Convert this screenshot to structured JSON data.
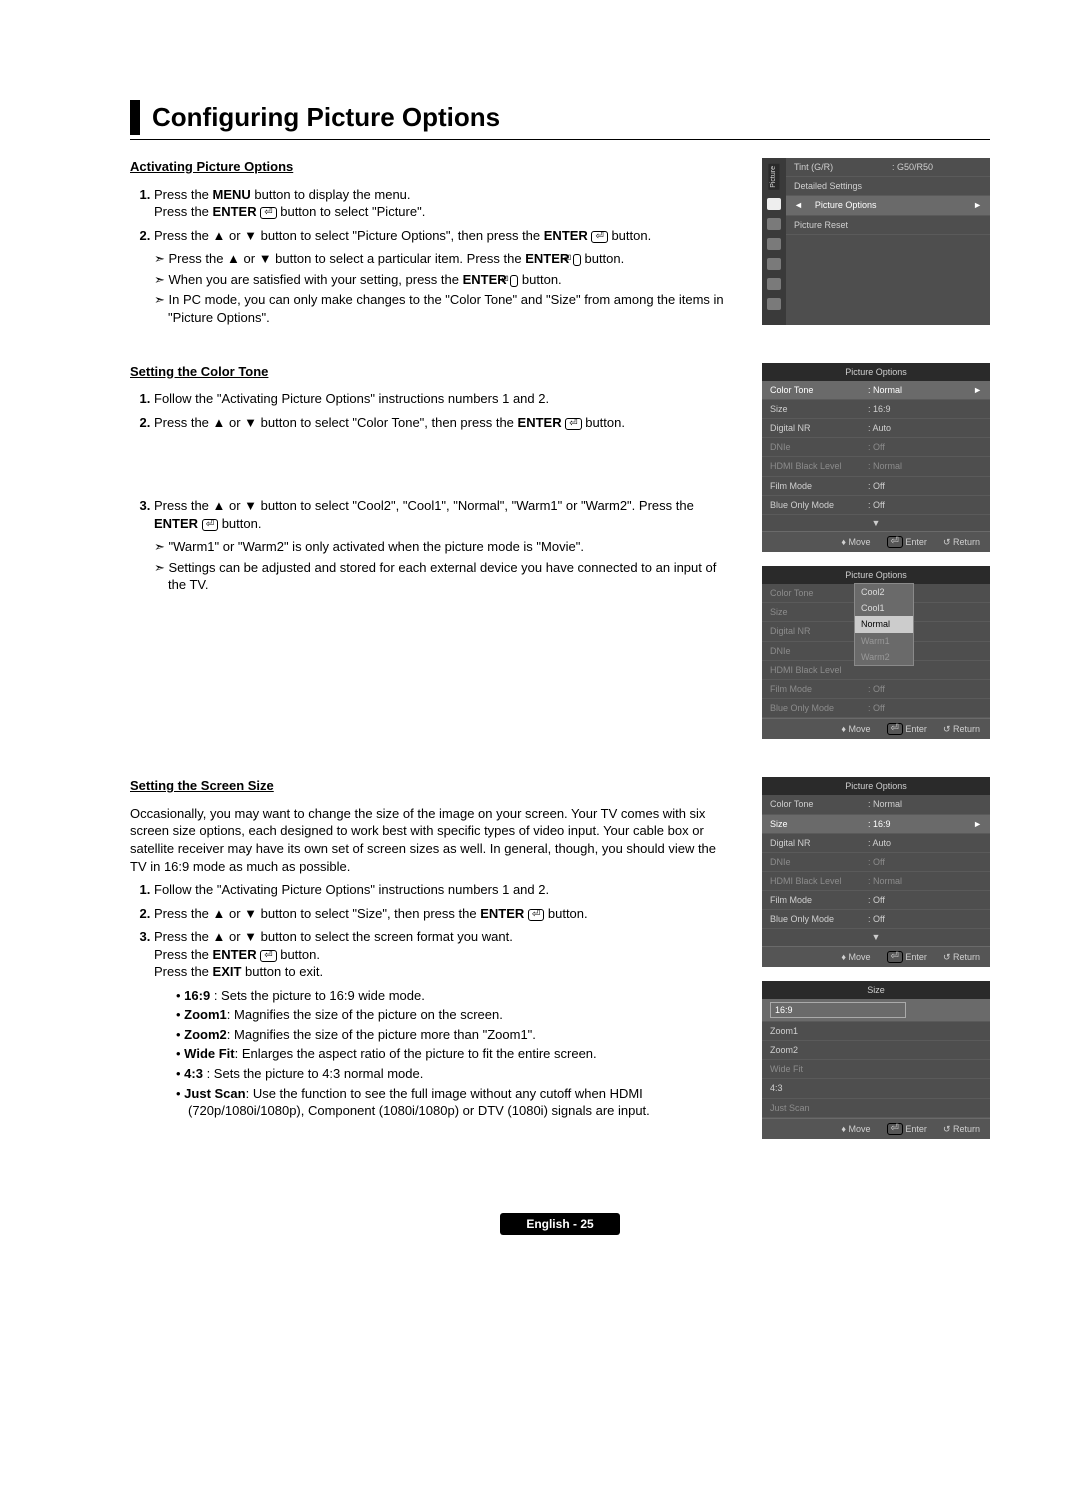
{
  "title": "Configuring Picture Options",
  "footer": "English - 25",
  "sectionA": {
    "subhead": "Activating Picture Options",
    "step1a": "Press the ",
    "step1b": " button to display the menu.",
    "step1c": "Press the ",
    "step1d": " button to select \"Picture\".",
    "menu": "MENU",
    "enter": "ENTER",
    "step2a": "Press the ▲ or ▼ button to select \"Picture Options\", then press the ",
    "step2b": " button.",
    "note1a": "Press the ▲ or ▼ button to select a particular item. Press the ",
    "note1b": " button.",
    "note2a": "When you are satisfied with your setting, press the ",
    "note2b": " button.",
    "note3": "In PC mode, you can only make changes to the \"Color Tone\" and \"Size\" from among the items in \"Picture Options\"."
  },
  "osd1": {
    "tab": "Picture",
    "rows": [
      {
        "k": "Tint (G/R)",
        "v": ": G50/R50"
      },
      {
        "k": "Detailed Settings",
        "v": ""
      }
    ],
    "sel": {
      "k": "Picture Options",
      "v": ""
    },
    "below": {
      "k": "Picture Reset",
      "v": ""
    }
  },
  "sectionB": {
    "subhead": "Setting the Color Tone",
    "step1": "Follow the \"Activating Picture Options\" instructions numbers 1 and 2.",
    "step2a": "Press the ▲ or ▼ button to select \"Color Tone\", then press the ",
    "step2b": " button.",
    "step3a": "Press the ▲ or ▼ button to select \"Cool2\", \"Cool1\", \"Normal\", \"Warm1\" or \"Warm2\". Press the ",
    "step3b": " button.",
    "note1": "\"Warm1\" or \"Warm2\" is only activated when the picture mode is \"Movie\".",
    "note2": "Settings can be adjusted and stored for each external device you have connected to an input of the TV."
  },
  "osd2": {
    "title": "Picture Options",
    "rows": [
      {
        "k": "Color Tone",
        "v": ": Normal",
        "sel": true
      },
      {
        "k": "Size",
        "v": ": 16:9"
      },
      {
        "k": "Digital NR",
        "v": ": Auto"
      },
      {
        "k": "DNIe",
        "v": ": Off",
        "dim": true
      },
      {
        "k": "HDMI Black Level",
        "v": ": Normal",
        "dim": true
      },
      {
        "k": "Film Mode",
        "v": ": Off"
      },
      {
        "k": "Blue Only Mode",
        "v": ": Off"
      }
    ],
    "foot": {
      "move": "Move",
      "enter": "Enter",
      "ret": "Return"
    }
  },
  "osd3": {
    "title": "Picture Options",
    "labels": [
      "Color Tone",
      "Size",
      "Digital NR",
      "DNIe",
      "HDMI Black Level",
      "Film Mode",
      "Blue Only Mode"
    ],
    "vals": [
      "",
      "",
      "",
      "",
      "",
      "Off",
      "Off"
    ],
    "dd": [
      "Cool2",
      "Cool1",
      "Normal",
      "Warm1",
      "Warm2"
    ]
  },
  "sectionC": {
    "subhead": "Setting the Screen Size",
    "intro": "Occasionally, you may want to change the size of the image on your screen. Your TV comes with six screen size options, each designed to work best with specific types of video input. Your cable box or satellite receiver may have its own set of screen sizes as well. In general, though, you should view the TV in 16:9 mode as much as possible.",
    "step1": "Follow the \"Activating Picture Options\" instructions numbers 1 and 2.",
    "step2a": "Press the ▲ or ▼ button to select \"Size\", then press the ",
    "step2b": " button.",
    "step3a": "Press the ▲ or ▼ button to select the screen format you want.",
    "step3b": "Press the ",
    "step3c": " button.",
    "step3d": "Press the ",
    "exit": "EXIT",
    "step3e": " button to exit.",
    "bullets": [
      {
        "b": "16:9",
        "t": " : Sets the picture to 16:9 wide mode."
      },
      {
        "b": "Zoom1",
        "t": ": Magnifies the size of the picture on the screen."
      },
      {
        "b": "Zoom2",
        "t": ": Magnifies the size of the picture more than \"Zoom1\"."
      },
      {
        "b": "Wide Fit",
        "t": ": Enlarges the aspect ratio of the picture to fit the entire screen."
      },
      {
        "b": "4:3",
        "t": " : Sets the picture to 4:3 normal mode."
      },
      {
        "b": "Just Scan",
        "t": ": Use the function to see the full image without any cutoff when HDMI (720p/1080i/1080p), Component (1080i/1080p) or DTV (1080i) signals are input."
      }
    ]
  },
  "osd4": {
    "title": "Picture Options",
    "rows": [
      {
        "k": "Color Tone",
        "v": ": Normal"
      },
      {
        "k": "Size",
        "v": ": 16:9",
        "sel": true
      },
      {
        "k": "Digital NR",
        "v": ": Auto"
      },
      {
        "k": "DNIe",
        "v": ": Off",
        "dim": true
      },
      {
        "k": "HDMI Black Level",
        "v": ": Normal",
        "dim": true
      },
      {
        "k": "Film Mode",
        "v": ": Off"
      },
      {
        "k": "Blue Only Mode",
        "v": ": Off"
      }
    ]
  },
  "osd5": {
    "title": "Size",
    "items": [
      "16:9",
      "Zoom1",
      "Zoom2",
      "Wide Fit",
      "4:3",
      "Just Scan"
    ]
  }
}
